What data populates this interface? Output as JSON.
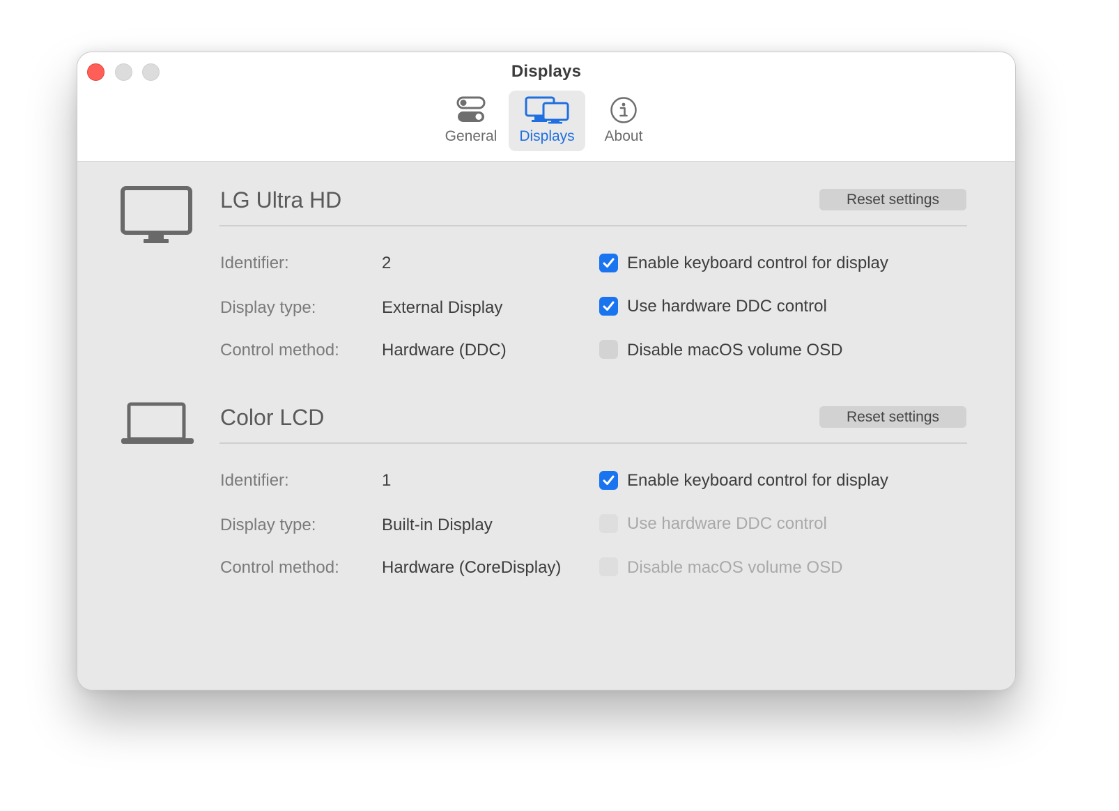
{
  "window": {
    "title": "Displays"
  },
  "toolbar": {
    "tabs": [
      {
        "label": "General",
        "icon": "toggles-icon"
      },
      {
        "label": "Displays",
        "icon": "displays-icon",
        "selected": true
      },
      {
        "label": "About",
        "icon": "info-icon"
      }
    ]
  },
  "colors": {
    "accent": "#1a74f0",
    "close": "#ff5f57",
    "background": "#e8e8e8"
  },
  "displays": [
    {
      "name": "LG Ultra HD",
      "icon": "monitor-icon",
      "reset_label": "Reset settings",
      "rows": [
        {
          "label": "Identifier:",
          "value": "2"
        },
        {
          "label": "Display type:",
          "value": "External Display"
        },
        {
          "label": "Control method:",
          "value": "Hardware (DDC)"
        }
      ],
      "options": [
        {
          "label": "Enable keyboard control for display",
          "checked": true,
          "enabled": true
        },
        {
          "label": "Use hardware DDC control",
          "checked": true,
          "enabled": true
        },
        {
          "label": "Disable macOS volume OSD",
          "checked": false,
          "enabled": true
        }
      ]
    },
    {
      "name": "Color LCD",
      "icon": "laptop-icon",
      "reset_label": "Reset settings",
      "rows": [
        {
          "label": "Identifier:",
          "value": "1"
        },
        {
          "label": "Display type:",
          "value": "Built-in Display"
        },
        {
          "label": "Control method:",
          "value": "Hardware (CoreDisplay)"
        }
      ],
      "options": [
        {
          "label": "Enable keyboard control for display",
          "checked": true,
          "enabled": true
        },
        {
          "label": "Use hardware DDC control",
          "checked": false,
          "enabled": false
        },
        {
          "label": "Disable macOS volume OSD",
          "checked": false,
          "enabled": false
        }
      ]
    }
  ]
}
